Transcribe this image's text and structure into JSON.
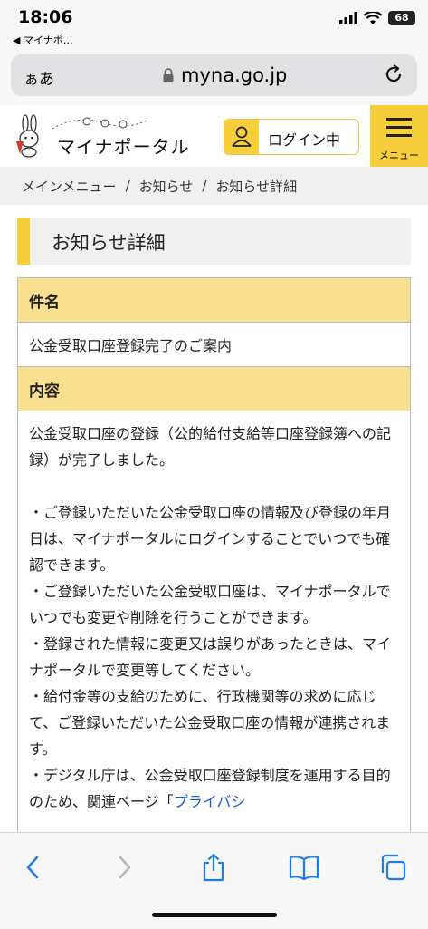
{
  "status_bar": {
    "time": "18:06",
    "back_app": "◀ マイナポ…",
    "battery": "68"
  },
  "address_bar": {
    "aa_label": "ぁあ",
    "domain": "myna.go.jp"
  },
  "site_header": {
    "logo_text": "マイナポータル",
    "login_label": "ログイン中",
    "menu_label": "メニュー"
  },
  "breadcrumb": {
    "items": [
      "メインメニュー",
      "お知らせ",
      "お知らせ詳細"
    ],
    "separator": "/"
  },
  "page_title": "お知らせ詳細",
  "detail": {
    "subject_header": "件名",
    "subject_value": "公金受取口座登録完了のご案内",
    "content_header": "内容",
    "paragraph_1": "公金受取口座の登録（公的給付支給等口座登録簿への記録）が完了しました。",
    "bullet_1": "・ご登録いただいた公金受取口座の情報及び登録の年月日は、マイナポータルにログインすることでいつでも確認できます。",
    "bullet_2": "・ご登録いただいた公金受取口座は、マイナポータルでいつでも変更や削除を行うことができます。",
    "bullet_3": "・登録された情報に変更又は誤りがあったときは、マイナポータルで変更等してください。",
    "bullet_4": "・給付金等の支給のために、行政機関等の求めに応じて、ご登録いただいた公金受取口座の情報が連携されます。",
    "bullet_5": "・デジタル庁は、公金受取口座登録制度を運用する目的のため、関連ページ「",
    "bullet_5_link": "プライバシ"
  },
  "colors": {
    "accent_yellow": "#f6cf3a",
    "table_header": "#f9e08f",
    "link_blue": "#1a5fd6",
    "ios_blue": "#1e7cf2"
  }
}
